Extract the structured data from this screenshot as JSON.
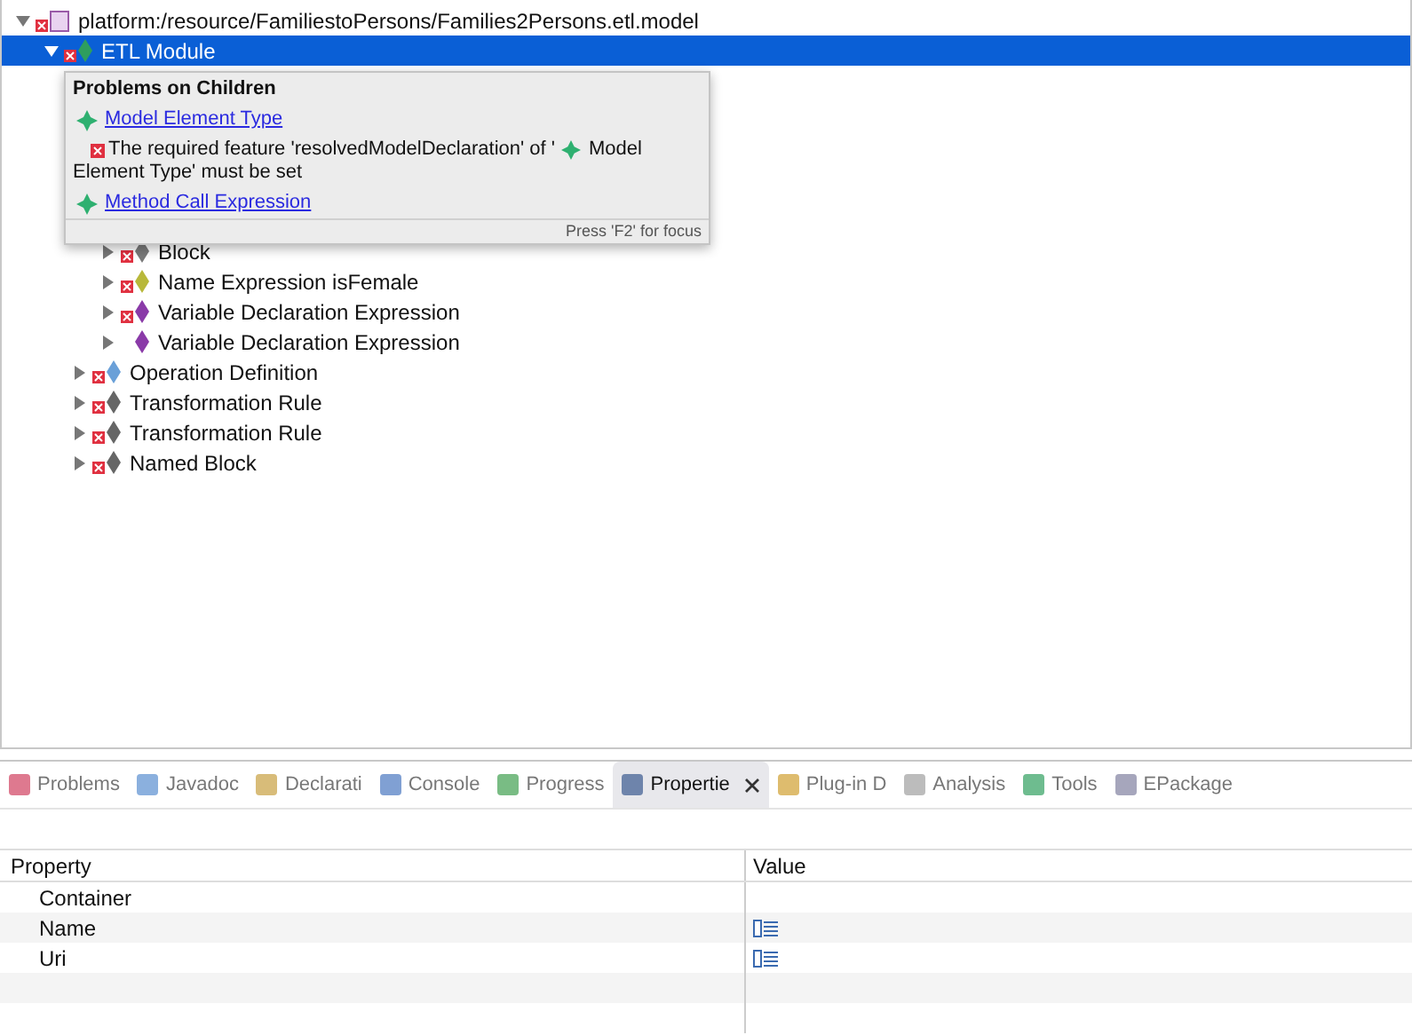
{
  "tree": {
    "label": "platform:/resource/FamiliestoPersons/Families2Persons.etl.model",
    "expanded": true,
    "selected": false,
    "error": true,
    "children": [
      {
        "label": "ETL Module",
        "expanded": true,
        "selected": true,
        "error": true,
        "color": "#2e9e5e",
        "children": [
          {
            "children": [
              {
                "label": "Block",
                "expanded": false,
                "selected": false,
                "error": true,
                "color": "#7a7a7a"
              },
              {
                "label": "Name Expression isFemale",
                "expanded": false,
                "selected": false,
                "error": true,
                "color": "#b8b83a"
              },
              {
                "label": "Variable Declaration Expression",
                "expanded": false,
                "selected": false,
                "error": true,
                "color": "#8a3aa8"
              },
              {
                "label": "Variable Declaration Expression",
                "expanded": false,
                "selected": false,
                "error": false,
                "color": "#8a3aa8"
              }
            ]
          },
          {
            "label": "Operation Definition",
            "expanded": false,
            "selected": false,
            "error": true,
            "color": "#6aa0d8"
          },
          {
            "label": "Transformation Rule",
            "expanded": false,
            "selected": false,
            "error": true,
            "color": "#666666"
          },
          {
            "label": "Transformation Rule",
            "expanded": false,
            "selected": false,
            "error": true,
            "color": "#666666"
          },
          {
            "label": "Named Block",
            "expanded": false,
            "selected": false,
            "error": true,
            "color": "#666666"
          }
        ]
      }
    ]
  },
  "tooltip": {
    "title": "Problems on Children",
    "link": "Model Element Type",
    "message_before": "The required feature 'resolvedModelDeclaration' of '",
    "message_after": [
      "Model",
      "Element Type' must be set"
    ],
    "link_2": "Method Call Expression",
    "footer": "Press 'F2' for focus"
  },
  "tabs": [
    {
      "label": "Problems",
      "selected": false
    },
    {
      "label": "Javadoc",
      "selected": false
    },
    {
      "label": "Declarati",
      "selected": false
    },
    {
      "label": "Console",
      "selected": false
    },
    {
      "label": "Progress",
      "selected": false
    },
    {
      "label": "Propertie",
      "selected": true
    },
    {
      "label": "Plug-in D",
      "selected": false
    },
    {
      "label": "Analysis",
      "selected": false
    },
    {
      "label": "Tools",
      "selected": false
    },
    {
      "label": "EPackage",
      "selected": false
    }
  ],
  "table": {
    "columns": [
      "Property",
      "Value"
    ],
    "rows": [
      {
        "property": "Container",
        "has_value": false
      },
      {
        "property": "Name",
        "has_value": true
      },
      {
        "property": "Uri",
        "has_value": true
      }
    ]
  }
}
